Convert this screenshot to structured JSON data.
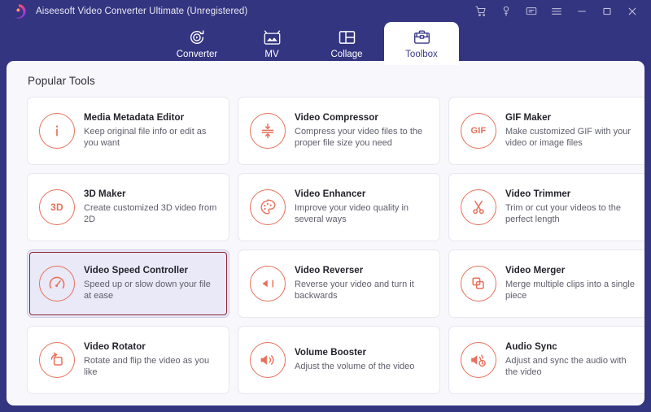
{
  "window": {
    "title": "Aiseesoft Video Converter Ultimate (Unregistered)",
    "logo_icon": "aiseesoft-swirl-logo",
    "accent_purple": "#343580",
    "accent_orange": "#e8705a",
    "panel_bg": "#f7f7fc",
    "selected_border": "#8e2436",
    "selected_bg": "#e9e9f7"
  },
  "window_controls": [
    {
      "name": "cart-icon",
      "label": "Cart"
    },
    {
      "name": "key-icon",
      "label": "Register"
    },
    {
      "name": "feedback-icon",
      "label": "Feedback"
    },
    {
      "name": "menu-icon",
      "label": "Menu"
    },
    {
      "name": "minimize-icon",
      "label": "Minimize"
    },
    {
      "name": "maximize-icon",
      "label": "Maximize"
    },
    {
      "name": "close-icon",
      "label": "Close"
    }
  ],
  "tabs": [
    {
      "id": "converter",
      "label": "Converter",
      "icon": "converter-icon",
      "active": false
    },
    {
      "id": "mv",
      "label": "MV",
      "icon": "mv-icon",
      "active": false
    },
    {
      "id": "collage",
      "label": "Collage",
      "icon": "collage-icon",
      "active": false
    },
    {
      "id": "toolbox",
      "label": "Toolbox",
      "icon": "toolbox-icon",
      "active": true
    }
  ],
  "main": {
    "section_title": "Popular Tools",
    "tools": [
      {
        "title": "Media Metadata Editor",
        "desc": "Keep original file info or edit as you want",
        "icon": "info-icon",
        "selected": false
      },
      {
        "title": "Video Compressor",
        "desc": "Compress your video files to the proper file size you need",
        "icon": "compress-icon",
        "selected": false
      },
      {
        "title": "GIF Maker",
        "desc": "Make customized GIF with your video or image files",
        "icon": "gif-icon",
        "icon_text": "GIF",
        "selected": false
      },
      {
        "title": "3D Maker",
        "desc": "Create customized 3D video from 2D",
        "icon": "3d-icon",
        "icon_text": "3D",
        "selected": false
      },
      {
        "title": "Video Enhancer",
        "desc": "Improve your video quality in several ways",
        "icon": "palette-icon",
        "selected": false
      },
      {
        "title": "Video Trimmer",
        "desc": "Trim or cut your videos to the perfect length",
        "icon": "scissors-icon",
        "selected": false
      },
      {
        "title": "Video Speed Controller",
        "desc": "Speed up or slow down your file at ease",
        "icon": "speedometer-icon",
        "selected": true
      },
      {
        "title": "Video Reverser",
        "desc": "Reverse your video and turn it backwards",
        "icon": "rewind-icon",
        "selected": false
      },
      {
        "title": "Video Merger",
        "desc": "Merge multiple clips into a single piece",
        "icon": "merge-icon",
        "selected": false
      },
      {
        "title": "Video Rotator",
        "desc": "Rotate and flip the video as you like",
        "icon": "rotate-icon",
        "selected": false
      },
      {
        "title": "Volume Booster",
        "desc": "Adjust the volume of the video",
        "icon": "volume-icon",
        "selected": false
      },
      {
        "title": "Audio Sync",
        "desc": "Adjust and sync the audio with the video",
        "icon": "audio-sync-icon",
        "selected": false
      }
    ]
  }
}
